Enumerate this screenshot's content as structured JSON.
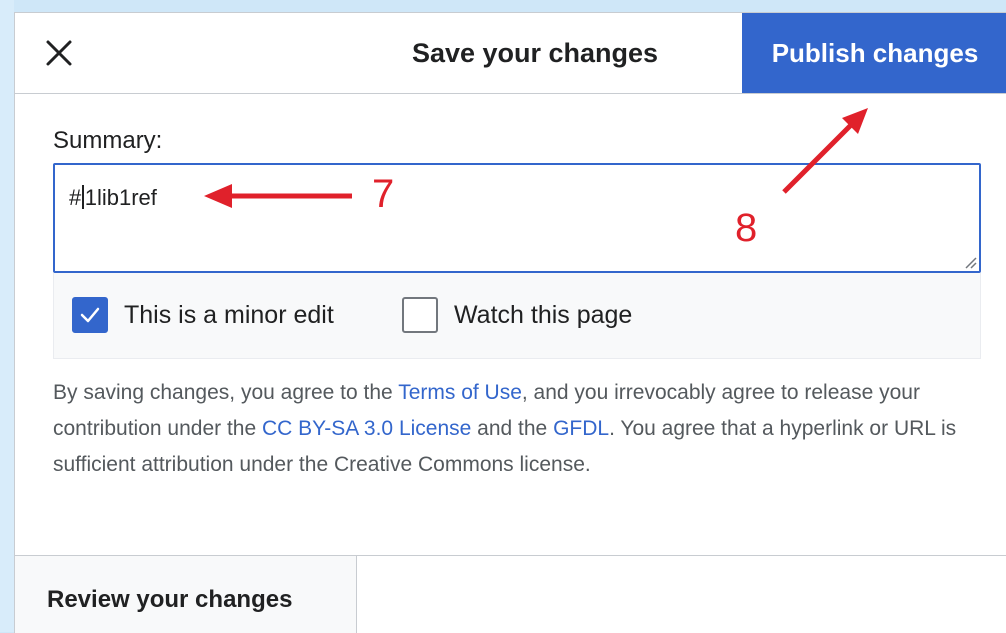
{
  "dialog": {
    "title": "Save your changes",
    "publish_label": "Publish changes",
    "close_icon": "close-icon"
  },
  "summary": {
    "label": "Summary:",
    "value_before_caret": "#",
    "value_after_caret": "1lib1ref"
  },
  "options": {
    "minor_edit": {
      "label": "This is a minor edit",
      "checked": true
    },
    "watch_page": {
      "label": "Watch this page",
      "checked": false
    }
  },
  "legal": {
    "part1": "By saving changes, you agree to the ",
    "terms_link": "Terms of Use",
    "part2": ", and you irrevocably agree to release your contribution under the ",
    "license_link": "CC BY-SA 3.0 License",
    "part3": " and the ",
    "gfdl_link": "GFDL",
    "part4": ". You agree that a hyperlink or URL is sufficient attribution under the Creative Commons license."
  },
  "review_tab": {
    "label": "Review your changes"
  },
  "annotations": {
    "step7": "7",
    "step8": "8"
  },
  "colors": {
    "accent": "#3366cc",
    "annotation": "#e0212b",
    "background": "#cfe7f8"
  }
}
